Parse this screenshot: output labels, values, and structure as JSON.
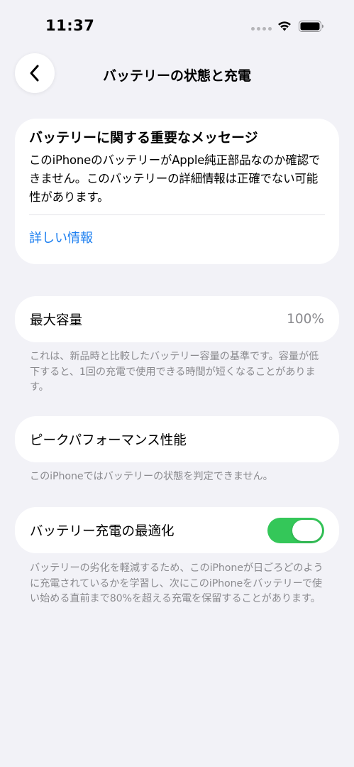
{
  "status_bar": {
    "time": "11:37"
  },
  "nav": {
    "title": "バッテリーの状態と充電",
    "back_icon": "chevron-left-icon"
  },
  "message_card": {
    "title": "バッテリーに関する重要なメッセージ",
    "body": "このiPhoneのバッテリーがApple純正部品なのか確認できません。このバッテリーの詳細情報は正確でない可能性があります。",
    "link": "詳しい情報"
  },
  "capacity": {
    "label": "最大容量",
    "value": "100%",
    "note": "これは、新品時と比較したバッテリー容量の基準です。容量が低下すると、1回の充電で使用できる時間が短くなることがあります。"
  },
  "peak": {
    "label": "ピークパフォーマンス性能",
    "note": "このiPhoneではバッテリーの状態を判定できません。"
  },
  "optimize": {
    "label": "バッテリー充電の最適化",
    "enabled": true,
    "toggle_color": "#34c759",
    "note": "バッテリーの劣化を軽減するため、このiPhoneが日ごろどのように充電されているかを学習し、次にこのiPhoneをバッテリーで使い始める直前まで80%を超える充電を保留することがあります。"
  },
  "colors": {
    "background": "#f2f2f7",
    "link": "#1c7ff0",
    "secondary_text": "#8a8a8e"
  }
}
